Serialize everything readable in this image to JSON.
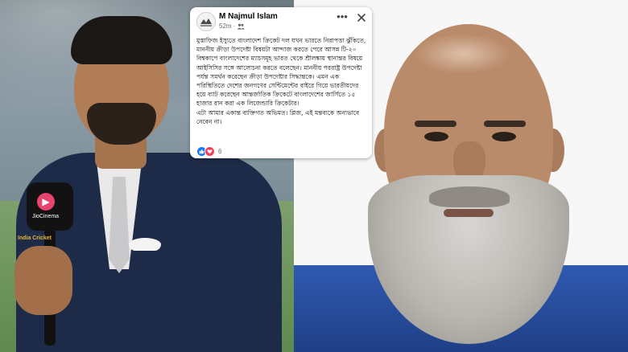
{
  "post": {
    "author": "M Najmul Islam",
    "time": "52m",
    "audience_icon": "friends-icon",
    "more_icon": "more-horizontal-icon",
    "close_icon": "close-icon",
    "body": [
      "মুস্তাফিজ ইস্যুতে বাংলাদেশ ক্রিকেট দল যখন ভারতে নিরাপত্তা ঝুঁকিতে, মাননীয় ক্রীড়া উপদেষ্টা বিষয়টা আন্দাজ করতে পেরে আসন্ন টি-২০ বিশ্বকাপে বাংলাদেশের ম্যাচসমূহ ভারত থেকে শ্রীলঙ্কায় স্থানান্তর বিষয়ে আইসিসির সঙ্গে আলোচনা করতে বলেছেন। মাননীয় পররাষ্ট্র উপদেষ্টা পর্যন্ত সমর্থন করেছেন ক্রীড়া উপদেষ্টার সিদ্ধান্তকে। এমন এক পরিস্থিতিতে দেশের জনগণের সেন্টিমেন্টের বাইরে গিয়ে ভারতীয়দের হয়ে ব্যাট করেছেন আন্তর্জাতিক ক্রিকেটে বাংলাদেশের জার্সিতে ১৫ হাজার রান করা এক লিজেন্ডারি ক্রিকেটার।",
      "এটা আমার একান্ত ব্যক্তিগত অভিমত। প্লিজ, এই মন্তব্যকে অন্যভাবে নেবেন না।"
    ],
    "reaction_count": "6",
    "reactions": [
      "like-icon",
      "love-icon"
    ]
  },
  "photos": {
    "left_mic_brand": "JioCinema",
    "left_channel_tag": "India Cricket"
  },
  "colors": {
    "like": "#1877f2",
    "love": "#f33e58",
    "right_shirt": "#2f59b0",
    "left_suit": "#1d2a48"
  }
}
